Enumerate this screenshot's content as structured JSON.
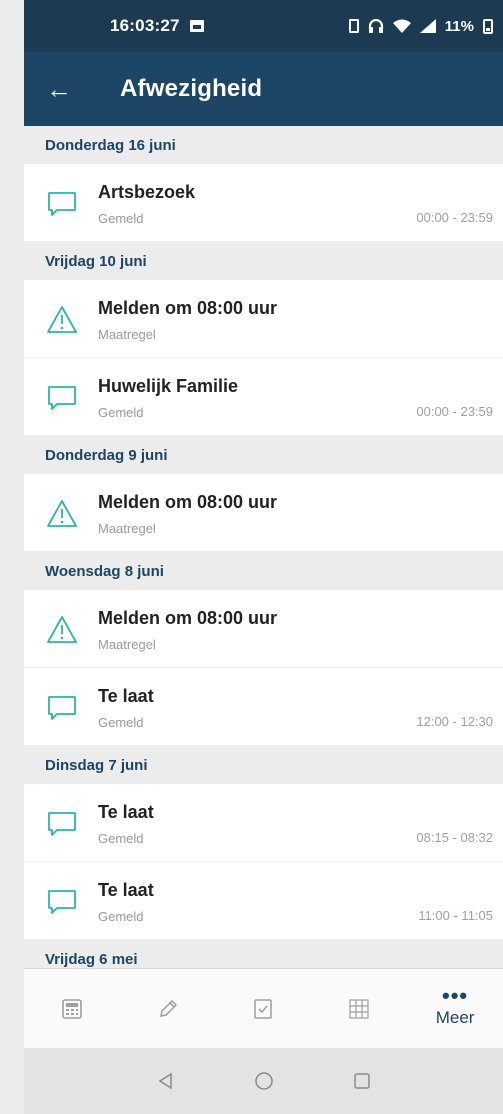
{
  "status_bar": {
    "time": "16:03:27",
    "battery": "11%"
  },
  "app_bar": {
    "title": "Afwezigheid"
  },
  "sections": [
    {
      "header": "Donderdag 16 juni",
      "items": [
        {
          "title": "Artsbezoek",
          "subtitle": "Gemeld",
          "time": "00:00 - 23:59",
          "icon": "chat-icon"
        }
      ]
    },
    {
      "header": "Vrijdag 10 juni",
      "items": [
        {
          "title": "Melden om 08:00 uur",
          "subtitle": "Maatregel",
          "time": "",
          "icon": "warning-icon"
        },
        {
          "title": "Huwelijk Familie",
          "subtitle": "Gemeld",
          "time": "00:00 - 23:59",
          "icon": "chat-icon"
        }
      ]
    },
    {
      "header": "Donderdag 9 juni",
      "items": [
        {
          "title": "Melden om 08:00 uur",
          "subtitle": "Maatregel",
          "time": "",
          "icon": "warning-icon"
        }
      ]
    },
    {
      "header": "Woensdag 8 juni",
      "items": [
        {
          "title": "Melden om 08:00 uur",
          "subtitle": "Maatregel",
          "time": "",
          "icon": "warning-icon"
        },
        {
          "title": "Te laat",
          "subtitle": "Gemeld",
          "time": "12:00 - 12:30",
          "icon": "chat-icon"
        }
      ]
    },
    {
      "header": "Dinsdag 7 juni",
      "items": [
        {
          "title": "Te laat",
          "subtitle": "Gemeld",
          "time": "08:15 - 08:32",
          "icon": "chat-icon"
        },
        {
          "title": "Te laat",
          "subtitle": "Gemeld",
          "time": "11:00 - 11:05",
          "icon": "chat-icon"
        }
      ]
    },
    {
      "header": "Vrijdag 6 mei",
      "items": []
    }
  ],
  "bottom_nav": {
    "items": [
      {
        "icon": "calculator-icon"
      },
      {
        "icon": "pencil-icon"
      },
      {
        "icon": "checkbox-icon"
      },
      {
        "icon": "grid-icon"
      },
      {
        "icon": "more-icon",
        "label": "Meer"
      }
    ]
  },
  "colors": {
    "primary": "#1d4565",
    "accent": "#2bb5a8",
    "status_bar": "#1d3a53"
  }
}
